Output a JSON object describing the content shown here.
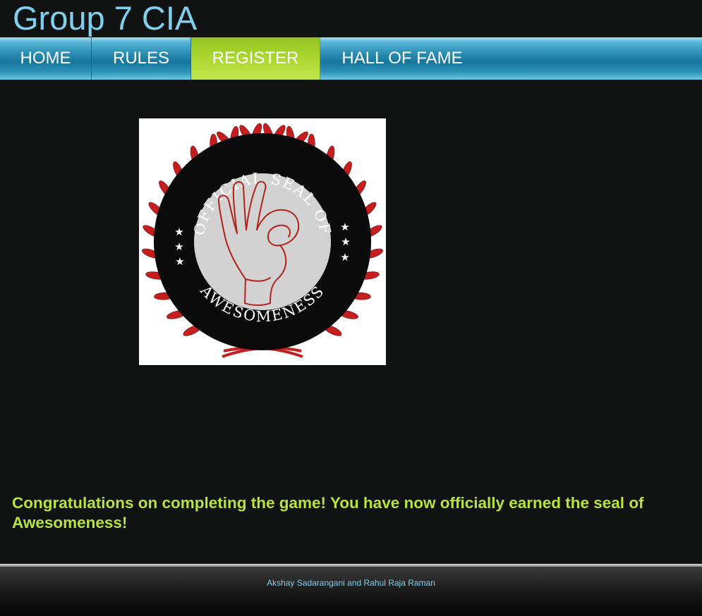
{
  "header": {
    "title": "Group 7 CIA"
  },
  "nav": {
    "items": [
      {
        "label": "HOME",
        "active": false
      },
      {
        "label": "RULES",
        "active": false
      },
      {
        "label": "REGISTER",
        "active": true
      },
      {
        "label": "HALL OF FAME",
        "active": false
      }
    ]
  },
  "seal": {
    "top_text": "OFFICIAL SEAL OF",
    "bottom_text": "AWESOMENESS"
  },
  "main": {
    "message": "Congratulations on completing the game! You have now officially earned the seal of Awesomeness!"
  },
  "footer": {
    "credit": "Akshay Sadarangani and Rahul Raja Raman"
  },
  "colors": {
    "title": "#7fd0ef",
    "nav_blue": "#17769a",
    "nav_active": "#a9d52e",
    "message": "#b9e33a",
    "background": "#111312",
    "seal_red": "#c41e1e"
  }
}
